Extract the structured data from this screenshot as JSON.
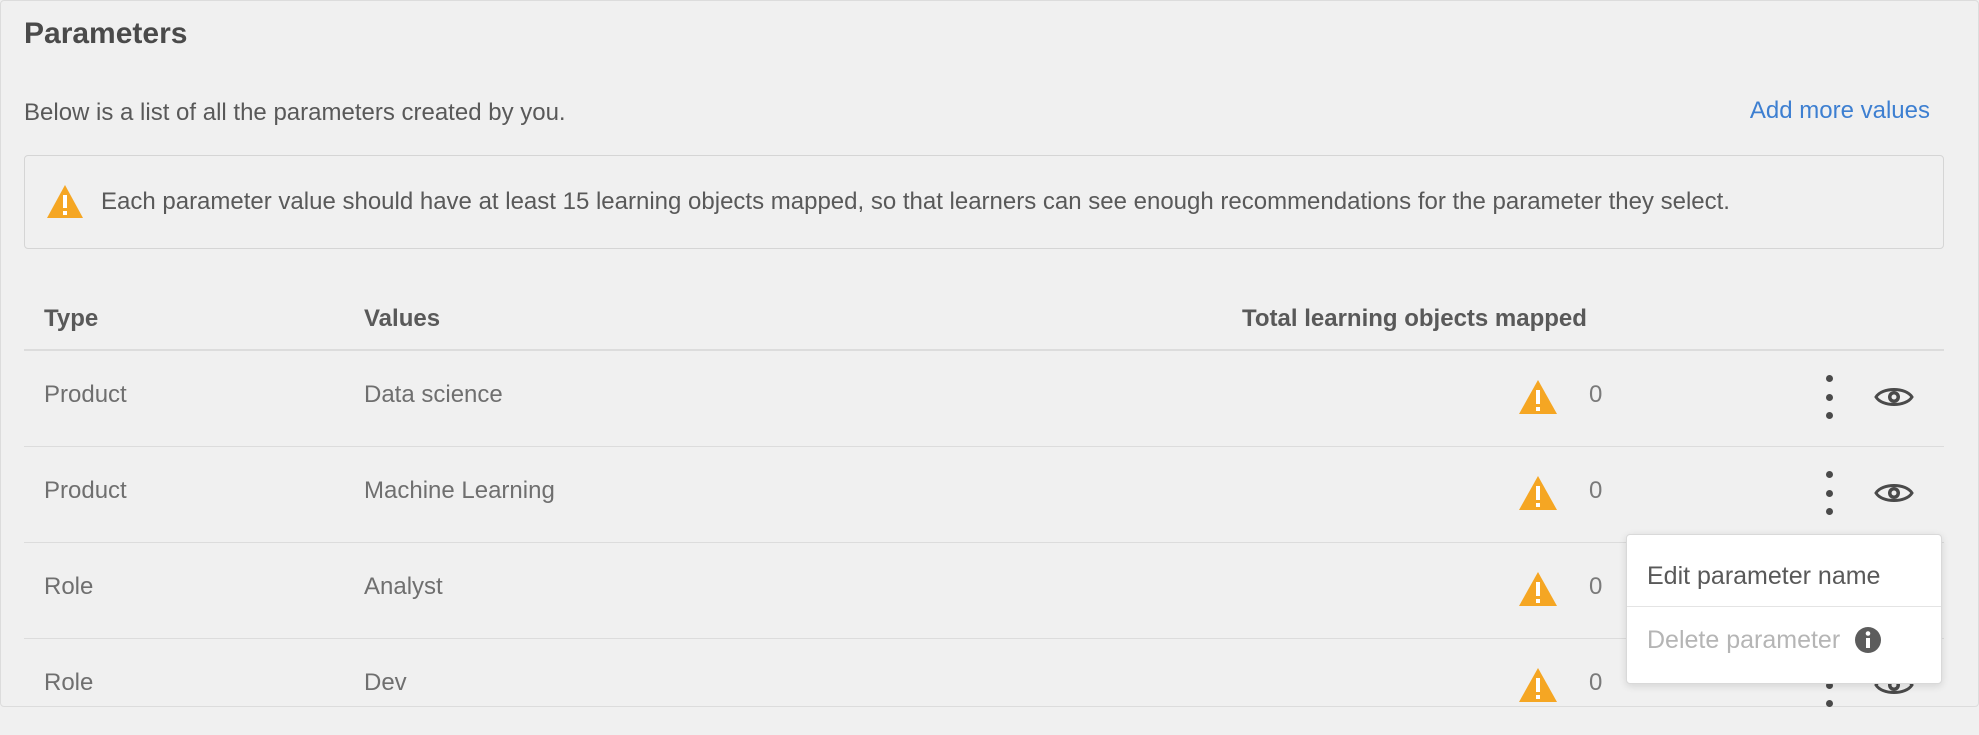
{
  "header": {
    "title": "Parameters",
    "subtitle": "Below is a list of all the parameters created by you.",
    "add_link": "Add more values"
  },
  "banner": {
    "icon": "warning-triangle-icon",
    "text": "Each parameter value should have at least 15 learning objects mapped, so that learners can see enough recommendations for the parameter they select."
  },
  "table": {
    "columns": [
      "Type",
      "Values",
      "Total learning objects mapped"
    ],
    "rows": [
      {
        "type": "Product",
        "value": "Data science",
        "count": "0"
      },
      {
        "type": "Product",
        "value": "Machine Learning",
        "count": "0"
      },
      {
        "type": "Role",
        "value": "Analyst",
        "count": "0"
      },
      {
        "type": "Role",
        "value": "Dev",
        "count": "0"
      }
    ]
  },
  "context_menu": {
    "edit": "Edit parameter name",
    "delete": "Delete parameter"
  },
  "colors": {
    "accent_link": "#3d7fd1",
    "warning": "#f5a623",
    "background": "#f0f0f0"
  }
}
